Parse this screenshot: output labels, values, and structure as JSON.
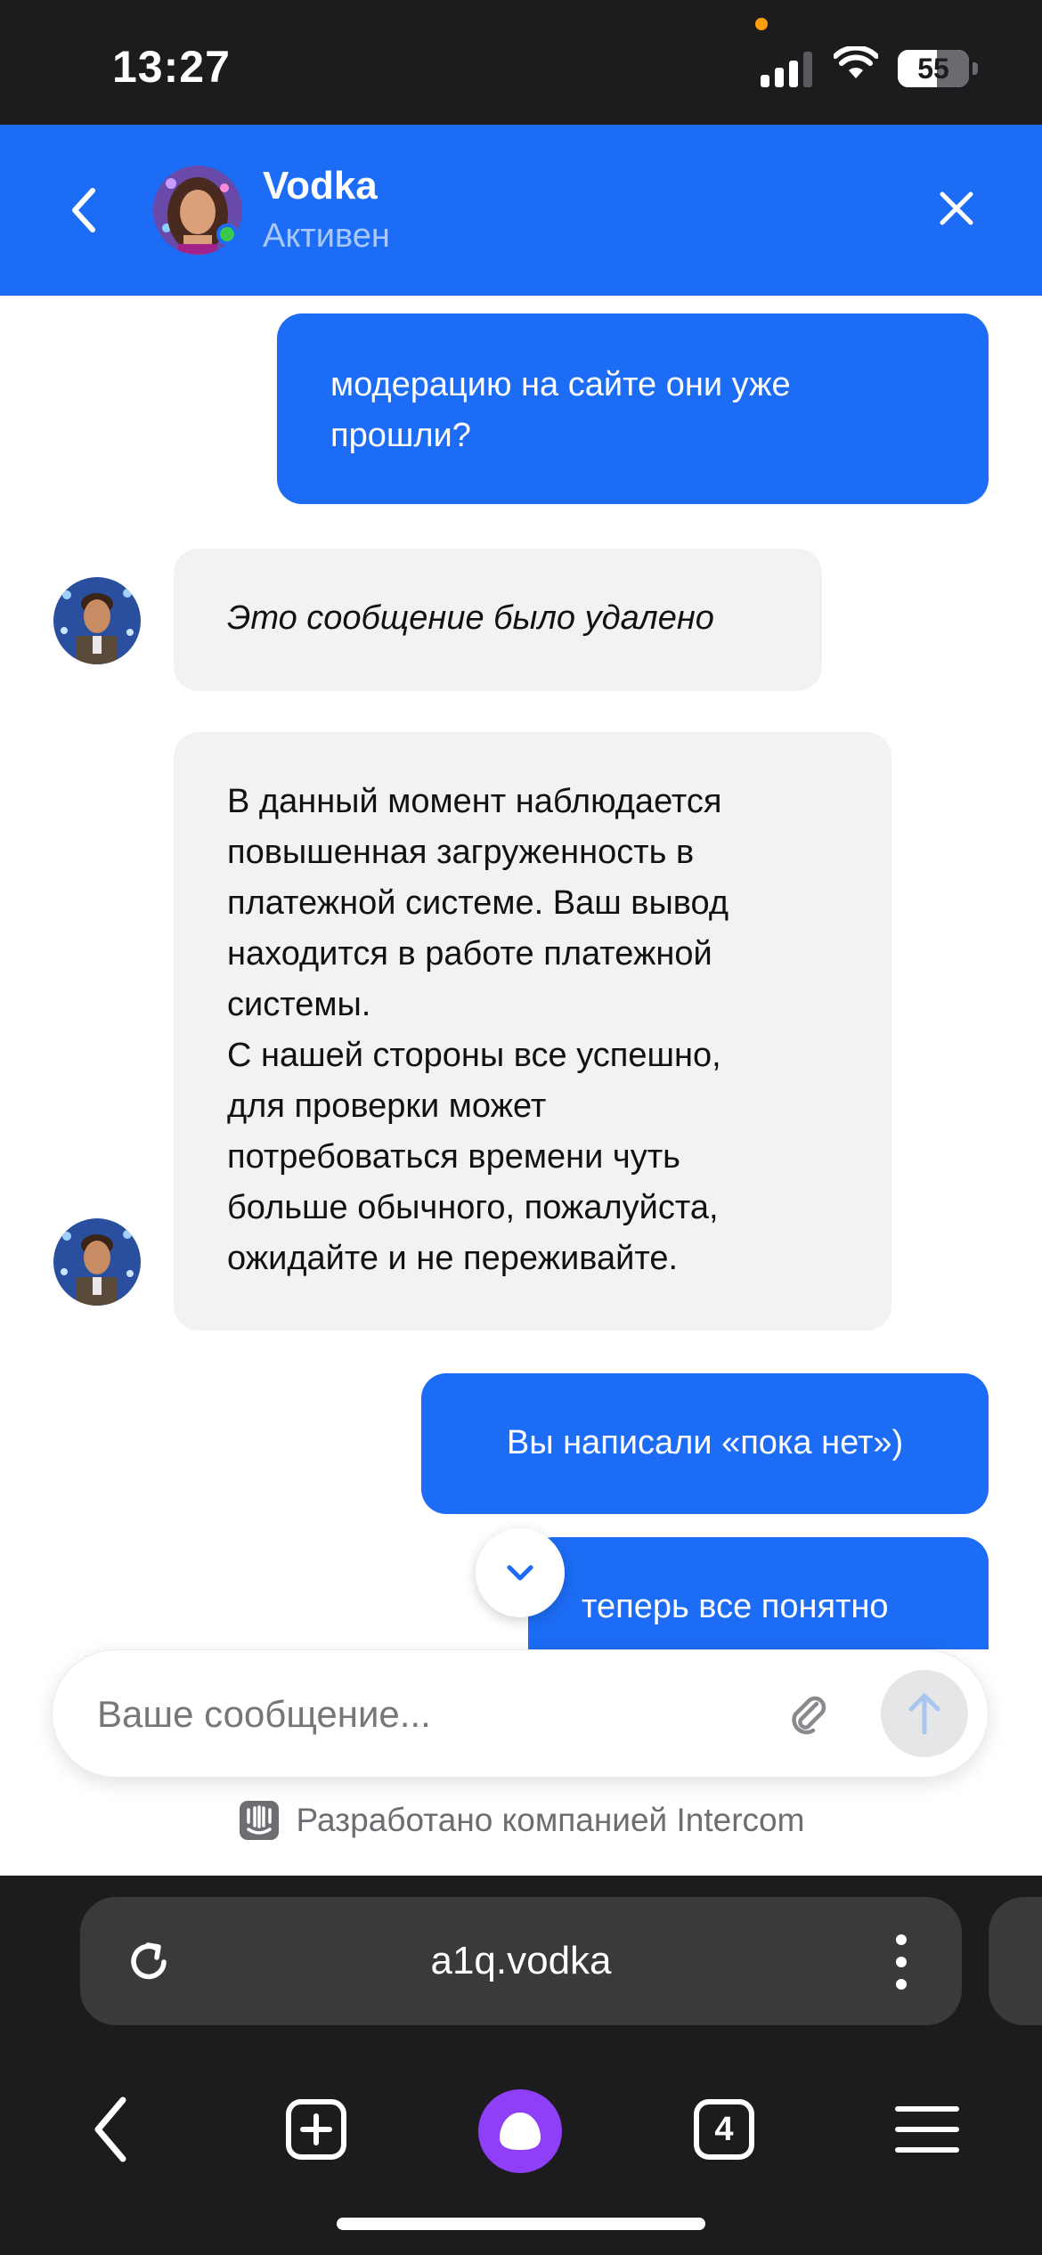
{
  "status_bar": {
    "time": "13:27",
    "battery": "55",
    "battery_level": 0.55
  },
  "header": {
    "agent_name": "Vodka",
    "agent_status": "Активен"
  },
  "messages": [
    {
      "from": "user",
      "text": "модерацию на сайте они уже\nпрошли?"
    },
    {
      "from": "agent",
      "text": "Это сообщение было удалено",
      "deleted": true
    },
    {
      "from": "agent",
      "text": "В данный момент наблюдается\nповышенная загруженность в\nплатежной системе. Ваш вывод\nнаходится в работе платежной\nсистемы.\nС нашей стороны все успешно,\nдля проверки может\nпотребоваться времени чуть\nбольше обычного, пожалуйста,\nожидайте и не переживайте."
    },
    {
      "from": "user",
      "text": "Вы написали «пока нет»)"
    },
    {
      "from": "user",
      "text": "теперь все понятно"
    }
  ],
  "composer": {
    "placeholder": "Ваше сообщение..."
  },
  "footer": {
    "powered_by": "Разработано компанией Intercom"
  },
  "browser": {
    "url": "a1q.vodka",
    "tab_count": "4"
  },
  "colors": {
    "accent": "#1d6cf5",
    "incoming_bubble": "#f2f2f3",
    "alice": "#8f3ff7"
  }
}
